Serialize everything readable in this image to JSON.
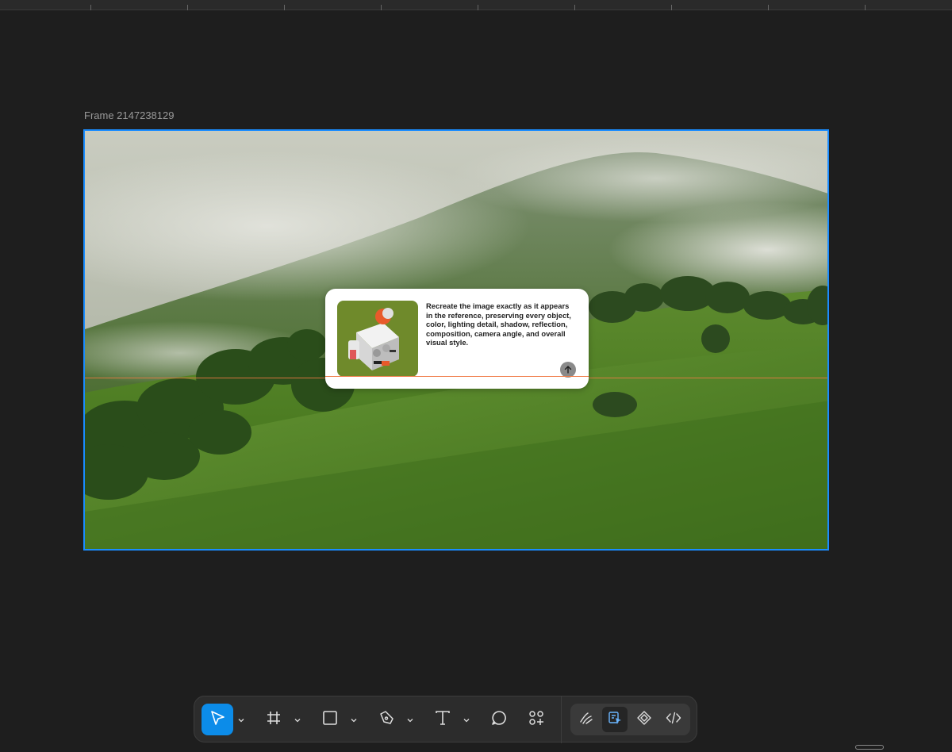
{
  "canvas": {
    "frame_name": "Frame 2147238129",
    "frame_selected": true,
    "selection_color": "#1a8cff",
    "guide_color": "#f07a45"
  },
  "prompt_card": {
    "text": "Recreate the image exactly as it appears in the reference, preserving every object, color, lighting detail, shadow, reflection, composition, camera angle, and overall visual style.",
    "thumbnail": "robot-cube-icon",
    "send_icon": "arrow-up-icon"
  },
  "toolbar": {
    "tools": [
      {
        "name": "move-tool",
        "icon": "cursor-arrow-icon",
        "active": true
      },
      {
        "name": "frame-tool",
        "icon": "hash-icon",
        "active": false
      },
      {
        "name": "shape-tool",
        "icon": "rectangle-icon",
        "active": false
      },
      {
        "name": "pen-tool",
        "icon": "pen-icon",
        "active": false
      },
      {
        "name": "text-tool",
        "icon": "text-icon",
        "active": false
      },
      {
        "name": "comment-tool",
        "icon": "comment-icon",
        "active": false
      },
      {
        "name": "actions-tool",
        "icon": "actions-grid-icon",
        "active": false
      }
    ],
    "modes": [
      {
        "name": "draw-mode",
        "icon": "draw-icon",
        "active": false
      },
      {
        "name": "design-mode",
        "icon": "design-icon",
        "active": true
      },
      {
        "name": "component-mode",
        "icon": "component-icon",
        "active": false
      },
      {
        "name": "dev-mode",
        "icon": "code-icon",
        "active": false
      }
    ],
    "accent_color": "#0c8ce9"
  }
}
